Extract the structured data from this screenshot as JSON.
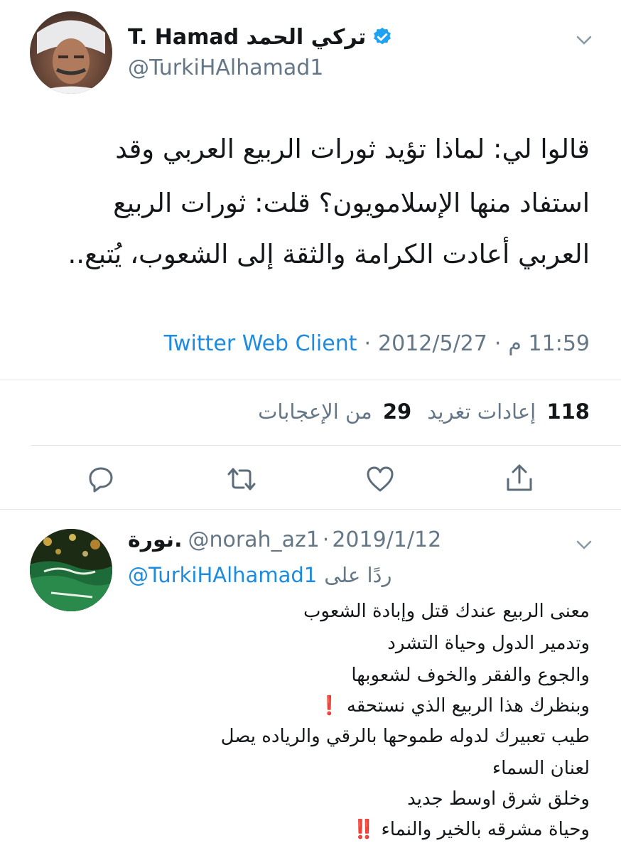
{
  "tweet": {
    "display_name": "T. Hamad تركي الحمد",
    "handle": "@TurkiHAlhamad1",
    "verified": true,
    "text_lines": [
      "قالوا لي: لماذا تؤيد ثورات الربيع العربي وقد",
      "استفاد منها الإسلامويون؟ قلت: ثورات الربيع",
      "العربي أعادت الكرامة والثقة إلى الشعوب، يُتبع.."
    ],
    "time": "11:59 م",
    "date": "2012/5/27",
    "client": "Twitter Web Client",
    "separator": "·",
    "retweets_count": "118",
    "retweets_label": "إعادات تغريد",
    "likes_count": "29",
    "likes_label": "من الإعجابات"
  },
  "actions": {
    "reply_icon": "reply-icon",
    "retweet_icon": "retweet-icon",
    "like_icon": "heart-icon",
    "share_icon": "share-icon"
  },
  "reply": {
    "display_name": "نورة.",
    "handle": "@norah_az1",
    "date": "2019/1/12",
    "replying_prefix": "ردًا على",
    "replying_to": "@TurkiHAlhamad1",
    "text_lines": [
      "معنى الربيع عندك قتل وإبادة الشعوب",
      "وتدمير الدول وحياة التشرد",
      "والجوع والفقر والخوف لشعوبها",
      "وبنظرك هذا الربيع الذي نستحقه ❗️",
      "طيب تعبيرك لدوله طموحها بالرقي والرياده يصل",
      "لعنان السماء",
      "وخلق شرق اوسط جديد",
      "وحياة مشرقه بالخير والنماء ‼️"
    ]
  },
  "colors": {
    "link_blue": "#1d8ce0",
    "verified_blue": "#1da1f2",
    "muted_gray": "#657786",
    "divider": "#dfe3e6"
  }
}
